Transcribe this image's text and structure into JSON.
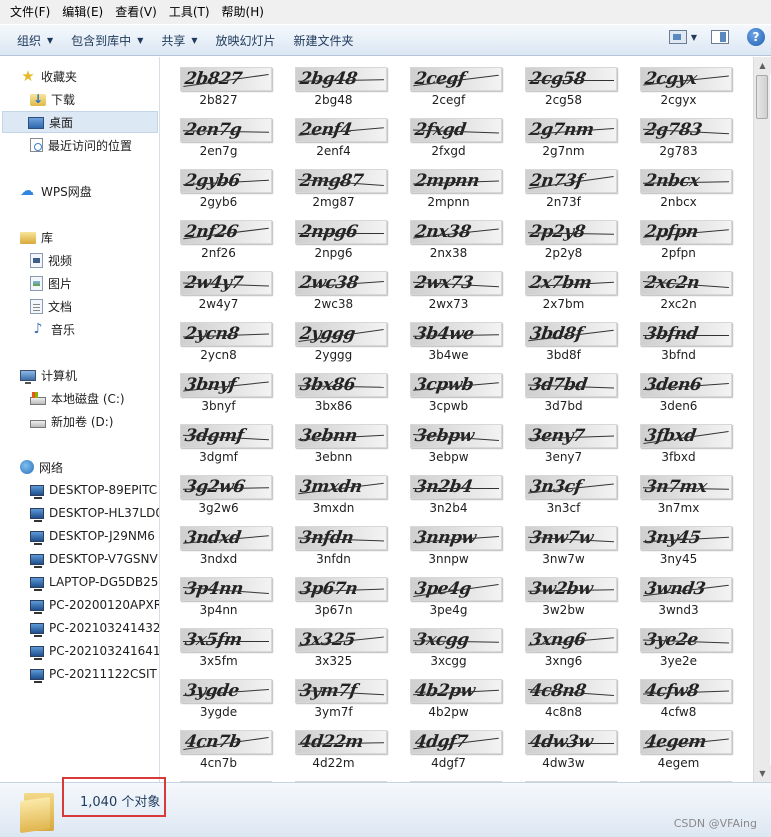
{
  "menu": [
    "文件(F)",
    "编辑(E)",
    "查看(V)",
    "工具(T)",
    "帮助(H)"
  ],
  "toolbar": {
    "organize": "组织",
    "include_library": "包含到库中",
    "share": "共享",
    "slideshow": "放映幻灯片",
    "new_folder": "新建文件夹",
    "help": "?"
  },
  "nav": {
    "favorites": "收藏夹",
    "downloads": "下载",
    "desktop": "桌面",
    "recent": "最近访问的位置",
    "wps": "WPS网盘",
    "libraries": "库",
    "videos": "视频",
    "pictures": "图片",
    "documents": "文档",
    "music": "音乐",
    "computer": "计算机",
    "drive_c": "本地磁盘 (C:)",
    "drive_d": "新加卷 (D:)",
    "network": "网络",
    "pcs": [
      "DESKTOP-89EPITC",
      "DESKTOP-HL37LD0",
      "DESKTOP-J29NM6",
      "DESKTOP-V7GSNV",
      "LAPTOP-DG5DB25",
      "PC-20200120APXR",
      "PC-202103241432",
      "PC-202103241641",
      "PC-20211122CSIT"
    ]
  },
  "files": [
    "2b827",
    "2bg48",
    "2cegf",
    "2cg58",
    "2cgyx",
    "2en7g",
    "2enf4",
    "2fxgd",
    "2g7nm",
    "2g783",
    "2gyb6",
    "2mg87",
    "2mpnn",
    "2n73f",
    "2nbcx",
    "2nf26",
    "2npg6",
    "2nx38",
    "2p2y8",
    "2pfpn",
    "2w4y7",
    "2wc38",
    "2wx73",
    "2x7bm",
    "2xc2n",
    "2ycn8",
    "2yggg",
    "3b4we",
    "3bd8f",
    "3bfnd",
    "3bnyf",
    "3bx86",
    "3cpwb",
    "3d7bd",
    "3den6",
    "3dgmf",
    "3ebnn",
    "3ebpw",
    "3eny7",
    "3fbxd",
    "3g2w6",
    "3mxdn",
    "3n2b4",
    "3n3cf",
    "3n7mx",
    "3ndxd",
    "3nfdn",
    "3nnpw",
    "3nw7w",
    "3ny45",
    "3p4nn",
    "3p67n",
    "3pe4g",
    "3w2bw",
    "3wnd3",
    "3x5fm",
    "3x325",
    "3xcgg",
    "3xng6",
    "3ye2e",
    "3ygde",
    "3ym7f",
    "4b2pw",
    "4c8n8",
    "4cfw8",
    "4cn7b",
    "4d22m",
    "4dgf7",
    "4dw3w",
    "4egem"
  ],
  "status": {
    "count": "1,040 个对象",
    "watermark": "CSDN @VFAing"
  },
  "colors": {
    "highlight_box": "#d83a3a",
    "toolbar_text": "#1e395b"
  }
}
